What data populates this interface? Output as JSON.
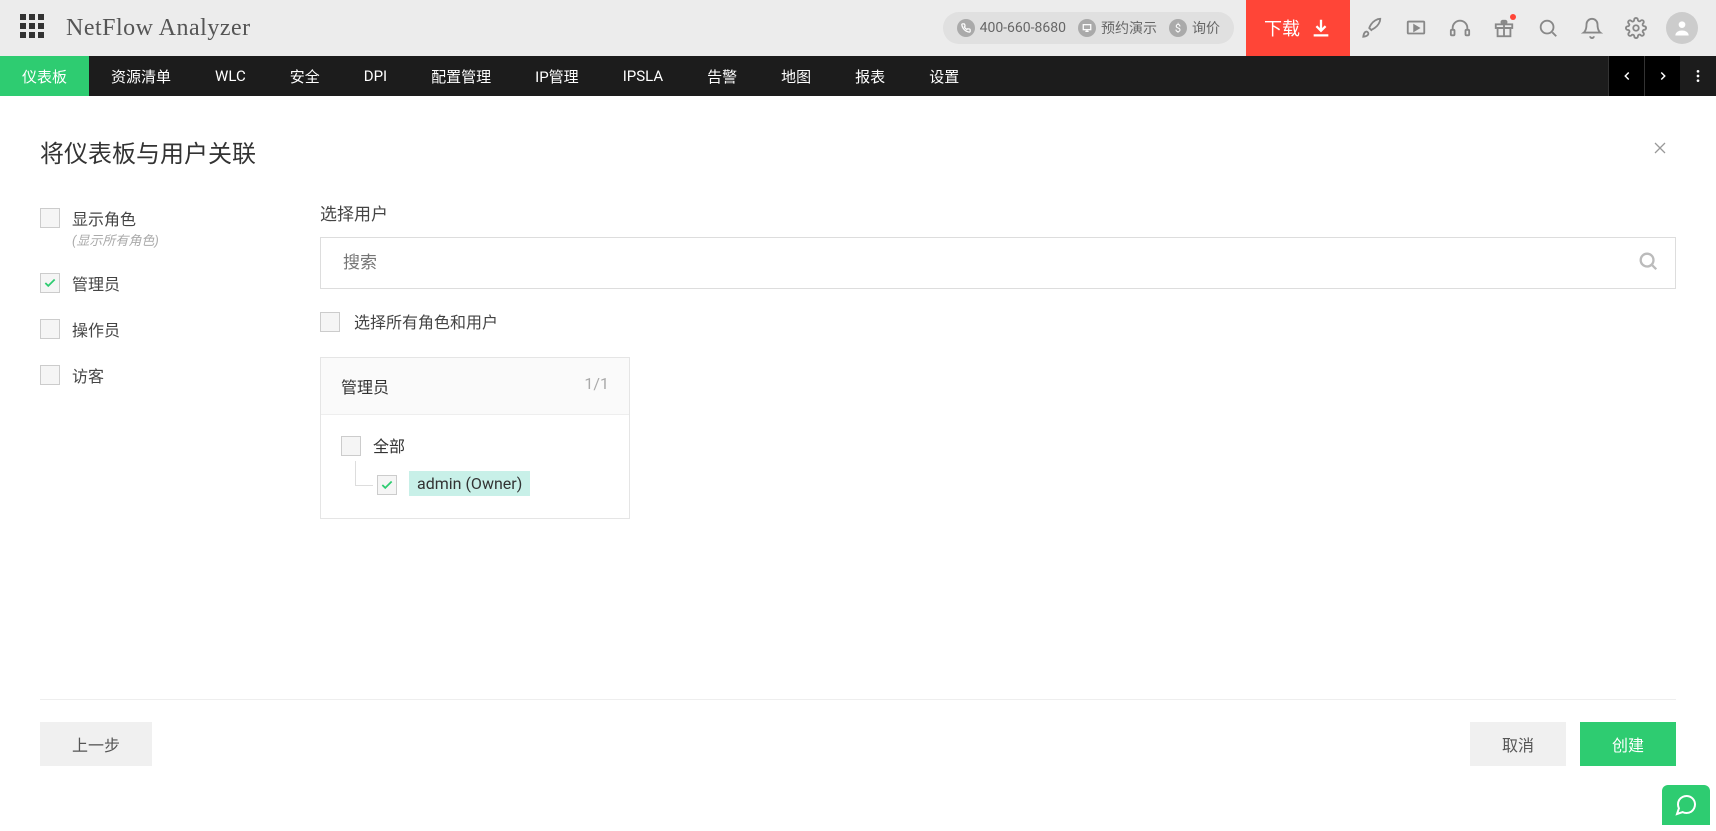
{
  "header": {
    "app_title": "NetFlow Analyzer",
    "phone": "400-660-8680",
    "demo_label": "预约演示",
    "quote_label": "询价",
    "download_label": "下载"
  },
  "nav": {
    "items": [
      "仪表板",
      "资源清单",
      "WLC",
      "安全",
      "DPI",
      "配置管理",
      "IP管理",
      "IPSLA",
      "告警",
      "地图",
      "报表",
      "设置"
    ],
    "active_index": 0
  },
  "page": {
    "title": "将仪表板与用户关联"
  },
  "sidebar": {
    "show_roles_label": "显示角色",
    "show_roles_sub": "(显示所有角色)",
    "roles": [
      {
        "label": "管理员",
        "checked": true
      },
      {
        "label": "操作员",
        "checked": false
      },
      {
        "label": "访客",
        "checked": false
      }
    ]
  },
  "main": {
    "select_user_label": "选择用户",
    "search_placeholder": "搜索",
    "select_all_label": "选择所有角色和用户",
    "card": {
      "role_title": "管理员",
      "count": "1/1",
      "all_label": "全部",
      "user_name": "admin (Owner)"
    }
  },
  "footer": {
    "prev": "上一步",
    "cancel": "取消",
    "create": "创建"
  }
}
